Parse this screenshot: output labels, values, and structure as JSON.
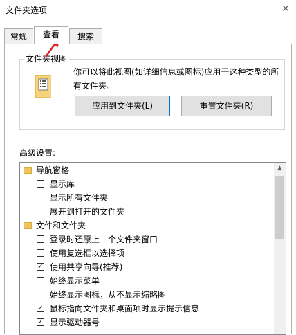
{
  "window": {
    "title": "文件夹选项"
  },
  "tabs": [
    {
      "label": "常规"
    },
    {
      "label": "查看"
    },
    {
      "label": "搜索"
    }
  ],
  "folder_view": {
    "legend": "文件夹视图",
    "description": "你可以将此视图(如详细信息或图标)应用于这种类型的所有文件夹。",
    "apply_button": "应用到文件夹(L)",
    "reset_button": "重置文件夹(R)"
  },
  "advanced": {
    "label": "高级设置:",
    "items": [
      {
        "type": "folder",
        "label": "导航窗格"
      },
      {
        "type": "checkbox",
        "label": "显示库",
        "checked": false
      },
      {
        "type": "checkbox",
        "label": "显示所有文件夹",
        "checked": false
      },
      {
        "type": "checkbox",
        "label": "展开到打开的文件夹",
        "checked": false
      },
      {
        "type": "folder",
        "label": "文件和文件夹"
      },
      {
        "type": "checkbox",
        "label": "登录时还原上一个文件夹窗口",
        "checked": false
      },
      {
        "type": "checkbox",
        "label": "使用复选框以选择项",
        "checked": false
      },
      {
        "type": "checkbox",
        "label": "使用共享向导(推荐)",
        "checked": true
      },
      {
        "type": "checkbox",
        "label": "始终显示菜单",
        "checked": false
      },
      {
        "type": "checkbox",
        "label": "始终显示图标，从不显示缩略图",
        "checked": false
      },
      {
        "type": "checkbox",
        "label": "鼠标指向文件夹和桌面项时显示提示信息",
        "checked": true
      },
      {
        "type": "checkbox",
        "label": "显示驱动器号",
        "checked": true
      }
    ]
  }
}
